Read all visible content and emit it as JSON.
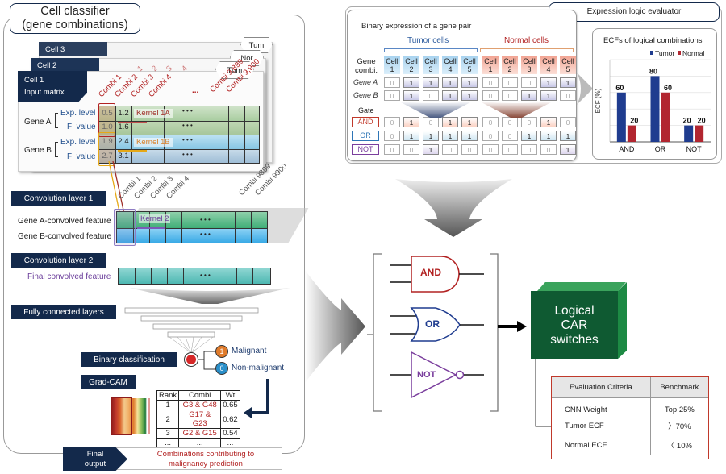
{
  "left_panel": {
    "title_line1": "Cell classifier",
    "title_line2": "(gene combinations)",
    "cell_cards": [
      {
        "label": "Cell 3",
        "tab": "Tum"
      },
      {
        "label": "Cell 2",
        "tab": "Nor"
      },
      {
        "label": "Cell 1",
        "sublabel": "Input matrix",
        "tab": "Tum"
      }
    ],
    "input_matrix": {
      "columns": [
        "Combi 1",
        "Combi 2",
        "Combi 3",
        "Combi 4",
        "...",
        "Combi 9,899",
        "Combi 9,900"
      ],
      "back_columns": [
        "1",
        "2",
        "3",
        "4"
      ],
      "gene_a": {
        "label": "Gene A",
        "rows": [
          {
            "label": "Exp. level",
            "values": [
              "0.5",
              "1.2"
            ]
          },
          {
            "label": "FI value",
            "values": [
              "1.0",
              "1.6"
            ]
          }
        ]
      },
      "gene_b": {
        "label": "Gene B",
        "rows": [
          {
            "label": "Exp. level",
            "values": [
              "1.9",
              "2.4"
            ]
          },
          {
            "label": "FI value",
            "values": [
              "2.7",
              "3.1"
            ]
          }
        ]
      },
      "kernel_1a": "Kernel 1A",
      "kernel_1b": "Kernel 1B",
      "ellipsis": "• • •"
    },
    "conv1": {
      "title": "Convolution layer 1",
      "columns": [
        "Combi 1",
        "Combi 2",
        "Combi 3",
        "Combi 4",
        "...",
        "Combi 9899",
        "Combi 9900"
      ],
      "row_a": "Gene A-convolved feature",
      "row_b": "Gene B-convolved feature",
      "kernel": "Kernel 2",
      "ellipsis": "• • •"
    },
    "conv2": {
      "title": "Convolution layer 2",
      "row": "Final convolved feature",
      "ellipsis": "• • •"
    },
    "fc": {
      "title": "Fully connected layers"
    },
    "binary": {
      "title": "Binary classification",
      "malignant_badge": "1",
      "malignant": "Malignant",
      "nonmalignant_badge": "0",
      "nonmalignant": "Non-malignant"
    },
    "gradcam": {
      "title": "Grad-CAM",
      "table_headers": [
        "Rank",
        "Combi",
        "Wt"
      ],
      "table_rows": [
        [
          "1",
          "G3 & G48",
          "0.65"
        ],
        [
          "2",
          "G17 & G23",
          "0.62"
        ],
        [
          "3",
          "G2 & G15",
          "0.54"
        ],
        [
          "...",
          "...",
          "..."
        ]
      ]
    },
    "final_output": {
      "label_line1": "Final",
      "label_line2": "output",
      "text_line1": "Combinations contributing to",
      "text_line2": "malignancy prediction"
    }
  },
  "evaluator": {
    "title": "Expression logic evaluator",
    "binary": {
      "title": "Binary expression of a gene pair",
      "tumor_label": "Tumor cells",
      "normal_label": "Normal cells",
      "gene_combi_label_1": "Gene",
      "gene_combi_label_2": "combi.",
      "cell_headers": [
        {
          "top": "Cell",
          "num": "1",
          "group": "tumor"
        },
        {
          "top": "Cell",
          "num": "2",
          "group": "tumor"
        },
        {
          "top": "Cell",
          "num": "3",
          "group": "tumor"
        },
        {
          "top": "Cell",
          "num": "4",
          "group": "tumor"
        },
        {
          "top": "Cell",
          "num": "5",
          "group": "tumor"
        },
        {
          "top": "Cell",
          "num": "1",
          "group": "normal"
        },
        {
          "top": "Cell",
          "num": "2",
          "group": "normal"
        },
        {
          "top": "Cell",
          "num": "3",
          "group": "normal"
        },
        {
          "top": "Cell",
          "num": "4",
          "group": "normal"
        },
        {
          "top": "Cell",
          "num": "5",
          "group": "normal"
        }
      ],
      "gene_a_label": "Gene A",
      "gene_b_label": "Gene B",
      "gene_a": [
        "0",
        "1",
        "1",
        "1",
        "1",
        "0",
        "0",
        "0",
        "1",
        "1"
      ],
      "gene_b": [
        "0",
        "1",
        "0",
        "1",
        "1",
        "0",
        "0",
        "1",
        "1",
        "0"
      ],
      "gate_label": "Gate",
      "gates": [
        {
          "name": "AND",
          "values": [
            "0",
            "1",
            "0",
            "1",
            "1",
            "0",
            "0",
            "0",
            "1",
            "0"
          ],
          "color": "#c0392b"
        },
        {
          "name": "OR",
          "values": [
            "0",
            "1",
            "1",
            "1",
            "1",
            "0",
            "0",
            "1",
            "1",
            "1"
          ],
          "color": "#2e75b6"
        },
        {
          "name": "NOT",
          "values": [
            "0",
            "0",
            "1",
            "0",
            "0",
            "0",
            "0",
            "0",
            "0",
            "1"
          ],
          "color": "#7a3e9d"
        }
      ]
    },
    "chart_data": {
      "type": "bar",
      "title": "ECFs of logical combinations",
      "categories": [
        "AND",
        "OR",
        "NOT"
      ],
      "series": [
        {
          "name": "Tumor",
          "values": [
            60,
            80,
            20
          ],
          "color": "#1f3c8f"
        },
        {
          "name": "Normal",
          "values": [
            20,
            60,
            20
          ],
          "color": "#b22630"
        }
      ],
      "xlabel": "",
      "ylabel": "ECF (%)",
      "ylim": [
        0,
        100
      ],
      "grid": true,
      "legend": "top-right"
    }
  },
  "gates_panel": {
    "and": "AND",
    "or": "OR",
    "not": "NOT"
  },
  "car_switch": {
    "line1": "Logical",
    "line2": "CAR",
    "line3": "switches"
  },
  "criteria_table": {
    "headers": [
      "Evaluation Criteria",
      "Benchmark"
    ],
    "rows": [
      [
        "CNN Weight",
        "Top 25%"
      ],
      [
        "Tumor ECF",
        "〉70%"
      ],
      [
        "Normal ECF",
        "〈 10%"
      ]
    ]
  },
  "colors": {
    "navy": "#13294b",
    "red": "#b22222",
    "green": "#1a6b3c",
    "tumor_blue": "#1f3c8f",
    "normal_red": "#b22630"
  }
}
